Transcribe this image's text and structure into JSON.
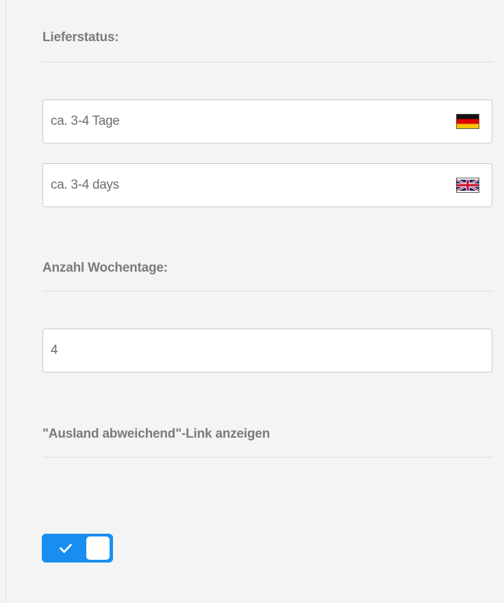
{
  "lieferstatus": {
    "title": "Lieferstatus:",
    "field_de": {
      "value": "ca. 3-4 Tage",
      "flag": "germany-flag-icon"
    },
    "field_en": {
      "value": "ca. 3-4 days",
      "flag": "uk-flag-icon"
    }
  },
  "wochentage": {
    "title": "Anzahl Wochentage:",
    "value": "4"
  },
  "ausland": {
    "title": "\"Ausland abweichend\"-Link anzeigen",
    "toggle_on": true,
    "toggle_color": "#1a8ef0"
  }
}
